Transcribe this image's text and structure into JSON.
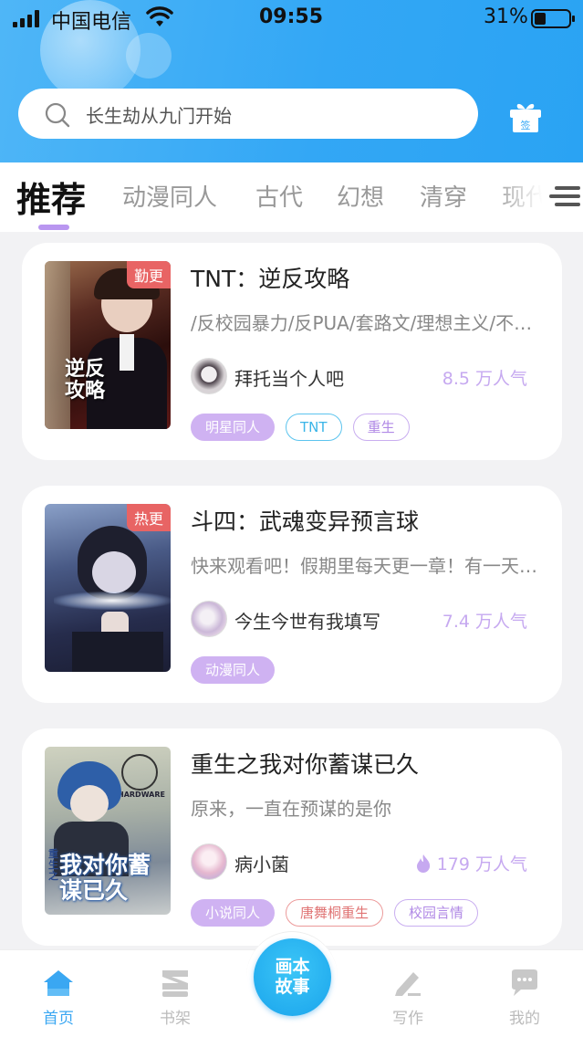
{
  "status_bar": {
    "carrier": "中国电信",
    "time": "09:55",
    "battery": "31%"
  },
  "search": {
    "placeholder": "长生劫从九门开始"
  },
  "gift": {
    "label": "签"
  },
  "tabs": [
    {
      "label": "推荐",
      "active": true
    },
    {
      "label": "动漫同人"
    },
    {
      "label": "古代"
    },
    {
      "label": "幻想"
    },
    {
      "label": "清穿"
    },
    {
      "label": "现代"
    }
  ],
  "books": [
    {
      "title": "TNT：逆反攻略",
      "badge": "勤更",
      "cover_title": "逆反攻略",
      "desc": "/反校园暴力/反PUA/套路文/理想主义/不虐主/原创二设",
      "author": "拜托当个人吧",
      "popularity": "8.5 万人气",
      "tags": [
        {
          "label": "明星同人",
          "style": "filled"
        },
        {
          "label": "TNT",
          "style": "blue"
        },
        {
          "label": "重生",
          "style": "purple"
        }
      ]
    },
    {
      "title": "斗四：武魂变异预言球",
      "badge": "热更",
      "desc": "快来观看吧！假期里每天更一章！有一天突然多了一章",
      "author": "今生今世有我填写",
      "popularity": "7.4 万人气",
      "tags": [
        {
          "label": "动漫同人",
          "style": "filled"
        }
      ]
    },
    {
      "title": "重生之我对你蓄谋已久",
      "desc": "原来，一直在预谋的是你",
      "author": "病小菌",
      "popularity": "179 万人气",
      "hot": true,
      "cover_title": "我对你蓄谋已久",
      "cover_small": "重生之",
      "cover_brand": "HARDWARE",
      "tags": [
        {
          "label": "小说同人",
          "style": "filled"
        },
        {
          "label": "唐舞桐重生",
          "style": "red"
        },
        {
          "label": "校园言情",
          "style": "purple"
        }
      ]
    }
  ],
  "bottom_nav": {
    "home": "首页",
    "shelf": "书架",
    "center": [
      "画本",
      "故事"
    ],
    "write": "写作",
    "mine": "我的"
  },
  "colors": {
    "accent": "#3aa7f2",
    "purple": "#c6a9f0",
    "badge_red": "#e86464"
  }
}
